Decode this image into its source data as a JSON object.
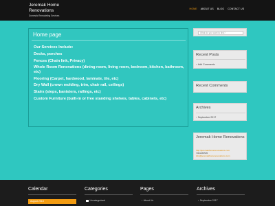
{
  "header": {
    "site_title": "Jeremak Home Renovations",
    "tagline": "Domestic Remodeling Services",
    "nav": [
      "HOME",
      "ABOUT US",
      "BLOG",
      "CONTACT US"
    ]
  },
  "main": {
    "title": "Home page",
    "lines": [
      "Our Services Include:",
      "Decks, porches",
      "Fences (Chain link, Privacy)",
      "Whole Room Renovations (dining room, living room, bedroom, kitchen, bathroom, etc)",
      "Flooring (Carpet, hardwood, laminate, tile, etc)",
      "Dry Wall (crown molding, trim, chair rail, ceilings)",
      "Stairs (steps, banisters, railings, etc)",
      "Custom Furniture (built-in or free standing shelves, tables, cabinets, etc)"
    ]
  },
  "sidebar": {
    "search_placeholder": "What do you want to find?",
    "recent_posts": {
      "title": "Recent Posts",
      "items": [
        "Add Comments"
      ]
    },
    "recent_comments": {
      "title": "Recent Comments"
    },
    "archives": {
      "title": "Archives",
      "items": [
        "September 2017"
      ]
    },
    "company": {
      "title": "Jeremak Home Renovations",
      "lines": [
        "http://jeremakhomerenovations.com",
        "7064265595",
        "info@jeremakhomerenovations.com"
      ]
    }
  },
  "footer": {
    "calendar": {
      "title": "Calendar",
      "month": "August 2018"
    },
    "categories": {
      "title": "Categories",
      "items": [
        "Uncategorized"
      ]
    },
    "pages": {
      "title": "Pages",
      "items": [
        "About Us"
      ]
    },
    "archives": {
      "title": "Archives",
      "items": [
        "September 2017"
      ]
    }
  },
  "colors": {
    "background": "#2fc7c0",
    "header_bg": "#141414",
    "accent": "#f39c12",
    "widget_bg": "#eaeaea",
    "footer_bg": "#1c1c1c"
  }
}
